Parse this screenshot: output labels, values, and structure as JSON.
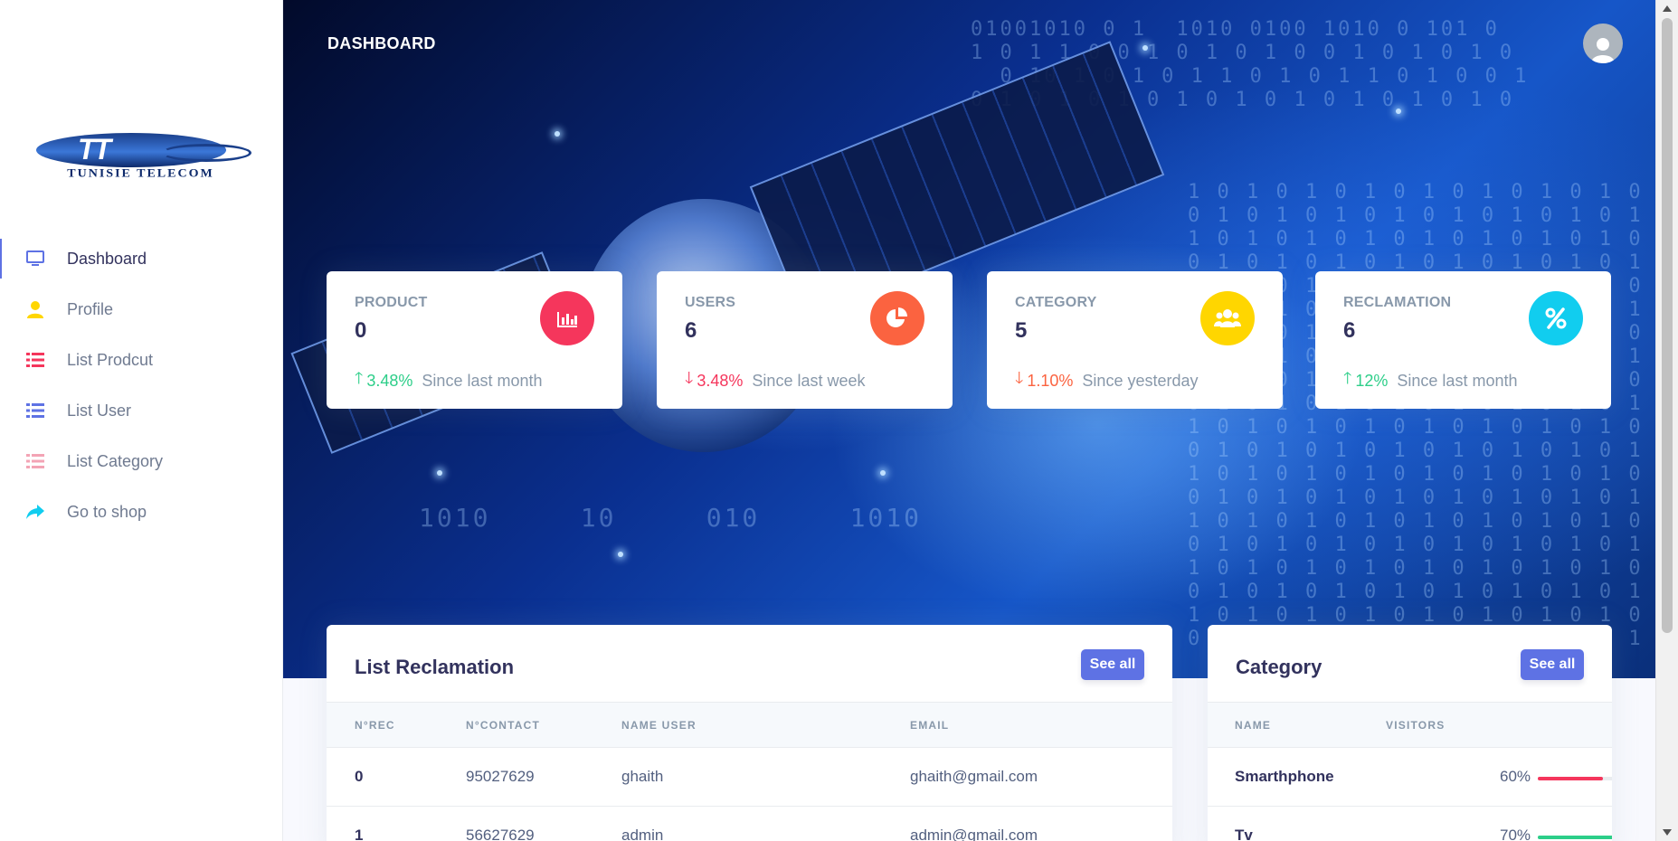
{
  "sidebar": {
    "logo_text": "TUNISIE TELECOM",
    "logo_mark": "TT",
    "items": [
      {
        "label": "Dashboard",
        "icon": "monitor-icon",
        "color": "#5e72e4"
      },
      {
        "label": "Profile",
        "icon": "user-icon",
        "color": "#ffd600"
      },
      {
        "label": "List Prodcut",
        "icon": "list-icon",
        "color": "#f5365c"
      },
      {
        "label": "List User",
        "icon": "list-icon",
        "color": "#5e72e4"
      },
      {
        "label": "List Category",
        "icon": "list-icon",
        "color": "#f3a4b5"
      },
      {
        "label": "Go to shop",
        "icon": "share-arrow-icon",
        "color": "#11cdef"
      }
    ]
  },
  "header": {
    "title": "DASHBOARD"
  },
  "stats": [
    {
      "title": "PRODUCT",
      "value": "0",
      "trend": "up",
      "pct": "3.48%",
      "since": "Since last month",
      "icon": "bar-chart-icon",
      "icon_color": "#f5365c"
    },
    {
      "title": "USERS",
      "value": "6",
      "trend": "down",
      "pct": "3.48%",
      "since": "Since last week",
      "icon": "pie-chart-icon",
      "icon_color": "#fb6340"
    },
    {
      "title": "CATEGORY",
      "value": "5",
      "trend": "down",
      "pct": "1.10%",
      "since": "Since yesterday",
      "icon": "users-icon",
      "icon_color": "#ffd600"
    },
    {
      "title": "RECLAMATION",
      "value": "6",
      "trend": "up",
      "pct": "12%",
      "since": "Since last month",
      "icon": "percent-icon",
      "icon_color": "#11cdef"
    }
  ],
  "reclamations": {
    "title": "List Reclamation",
    "see_all": "See all",
    "columns": [
      "N°REC",
      "N°CONTACT",
      "NAME USER",
      "EMAIL"
    ],
    "rows": [
      [
        "0",
        "95027629",
        "ghaith",
        "ghaith@gmail.com"
      ],
      [
        "1",
        "56627629",
        "admin",
        "admin@gmail.com"
      ]
    ]
  },
  "category": {
    "title": "Category",
    "see_all": "See all",
    "columns": [
      "NAME",
      "VISITORS"
    ],
    "rows": [
      {
        "name": "Smarthphone",
        "pct_label": "60%",
        "pct": 0.6,
        "color": "#f5365c"
      },
      {
        "name": "Tv",
        "pct_label": "70%",
        "pct": 0.7,
        "color": "#2dce89"
      }
    ]
  }
}
